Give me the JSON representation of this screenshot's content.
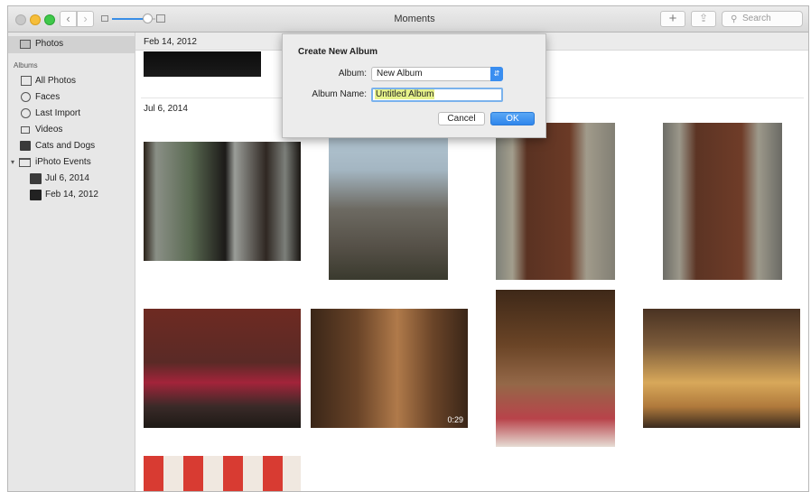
{
  "window": {
    "title": "Moments"
  },
  "toolbar": {
    "back_label": "‹",
    "forward_label": "›",
    "add_label": "+",
    "share_label": "⇪",
    "search_placeholder": "Search"
  },
  "sidebar": {
    "top_item": "Photos",
    "albums_heading": "Albums",
    "items": [
      {
        "label": "All Photos",
        "icon": "all-photos-icon"
      },
      {
        "label": "Faces",
        "icon": "faces-icon"
      },
      {
        "label": "Last Import",
        "icon": "clock-icon"
      },
      {
        "label": "Videos",
        "icon": "video-icon"
      },
      {
        "label": "Cats and Dogs",
        "icon": "album-thumb-icon"
      },
      {
        "label": "iPhoto Events",
        "icon": "folder-icon"
      },
      {
        "label": "Jul 6, 2014",
        "icon": "event-thumb-icon"
      },
      {
        "label": "Feb 14, 2012",
        "icon": "event-thumb-icon"
      }
    ],
    "disclosure": "▾"
  },
  "main": {
    "section1_date": "Feb 14, 2012",
    "section2_date": "Jul 6, 2014",
    "video_duration": "0:29"
  },
  "dialog": {
    "title": "Create New Album",
    "album_label": "Album:",
    "album_value": "New Album",
    "name_label": "Album Name:",
    "name_value": "Untitled Album",
    "cancel_label": "Cancel",
    "ok_label": "OK"
  }
}
